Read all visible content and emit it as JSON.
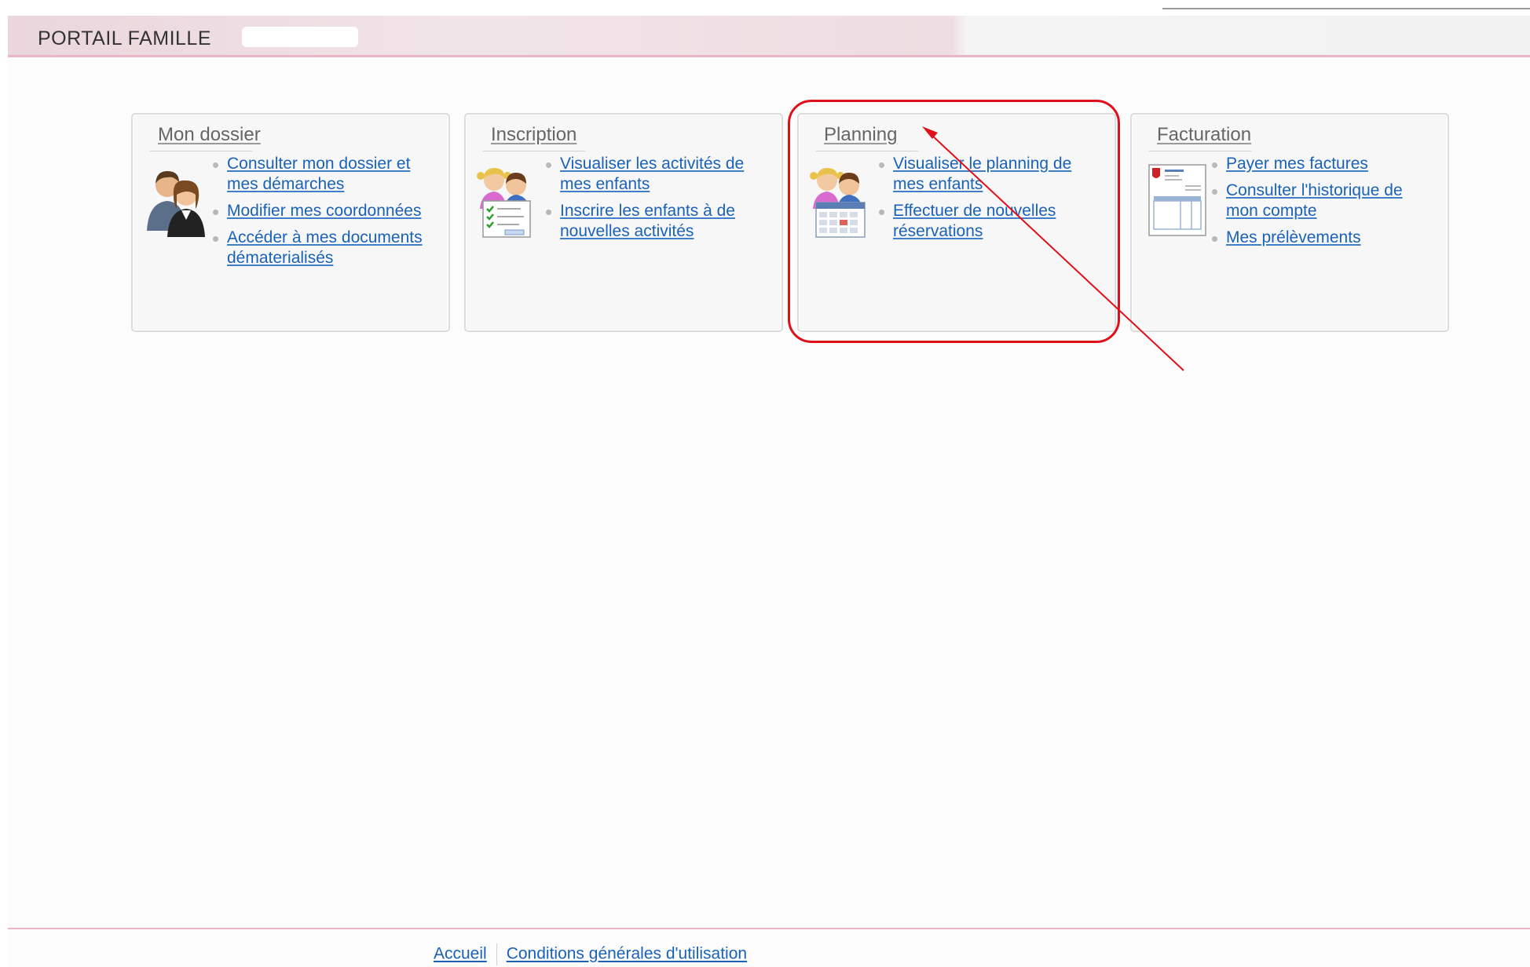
{
  "header": {
    "brand": "PORTAIL FAMILLE"
  },
  "cards": [
    {
      "title": "Mon dossier",
      "icon": "family-couple-icon",
      "links": [
        "Consulter mon dossier et mes démarches",
        "Modifier mes coordonnées",
        "Accéder à mes documents dématerialisés"
      ]
    },
    {
      "title": "Inscription",
      "icon": "children-checklist-icon",
      "links": [
        "Visualiser les activités de mes enfants",
        "Inscrire les enfants à de nouvelles activités"
      ]
    },
    {
      "title": "Planning",
      "icon": "children-calendar-icon",
      "links": [
        "Visualiser le planning de mes enfants",
        "Effectuer de nouvelles réservations"
      ]
    },
    {
      "title": "Facturation",
      "icon": "invoice-document-icon",
      "links": [
        "Payer mes factures",
        "Consulter l'historique de mon compte",
        "Mes prélèvements"
      ]
    }
  ],
  "annotation": {
    "color": "#e0101a"
  },
  "footer": {
    "links": [
      "Accueil",
      "Conditions générales d'utilisation"
    ]
  },
  "colors": {
    "link": "#1a62b8",
    "accent_pink": "#eab6c6"
  }
}
